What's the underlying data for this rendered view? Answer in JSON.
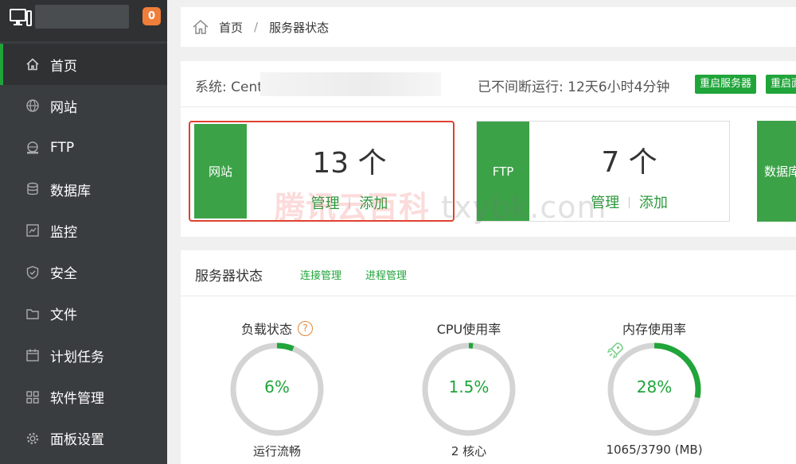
{
  "sidebar": {
    "badge": "0",
    "items": [
      {
        "label": "首页",
        "icon": "home-icon"
      },
      {
        "label": "网站",
        "icon": "globe-icon"
      },
      {
        "label": "FTP",
        "icon": "ftp-icon"
      },
      {
        "label": "数据库",
        "icon": "database-icon"
      },
      {
        "label": "监控",
        "icon": "monitor-icon"
      },
      {
        "label": "安全",
        "icon": "shield-icon"
      },
      {
        "label": "文件",
        "icon": "folder-icon"
      },
      {
        "label": "计划任务",
        "icon": "calendar-icon"
      },
      {
        "label": "软件管理",
        "icon": "apps-icon"
      },
      {
        "label": "面板设置",
        "icon": "gear-icon"
      }
    ]
  },
  "breadcrumb": {
    "home": "首页",
    "current": "服务器状态"
  },
  "sysbar": {
    "system_label": "系统: Cent",
    "uptime": "已不间断运行: 12天6小时4分钟",
    "restart_server": "重启服务器",
    "restart_panel": "重启面"
  },
  "cards": [
    {
      "label": "网站",
      "count": "13 个",
      "manage": "管理",
      "add": "添加"
    },
    {
      "label": "FTP",
      "count": "7 个",
      "manage": "管理",
      "add": "添加"
    },
    {
      "label": "数据库"
    }
  ],
  "status": {
    "title": "服务器状态",
    "links": [
      "连接管理",
      "进程管理"
    ],
    "gauges": [
      {
        "label": "负载状态",
        "value": "6%",
        "percent": 6,
        "sub": "运行流畅"
      },
      {
        "label": "CPU使用率",
        "value": "1.5%",
        "percent": 1.5,
        "sub": "2 核心"
      },
      {
        "label": "内存使用率",
        "value": "28%",
        "percent": 28,
        "sub": "1065/3790 (MB)"
      }
    ]
  },
  "watermark": {
    "part1": "腾讯云百科",
    "part2": "txybk.com"
  },
  "colors": {
    "accent": "#20a53a",
    "sidebar": "#3a3d40",
    "badge": "#ef7e3a",
    "highlight": "#e0412f"
  }
}
